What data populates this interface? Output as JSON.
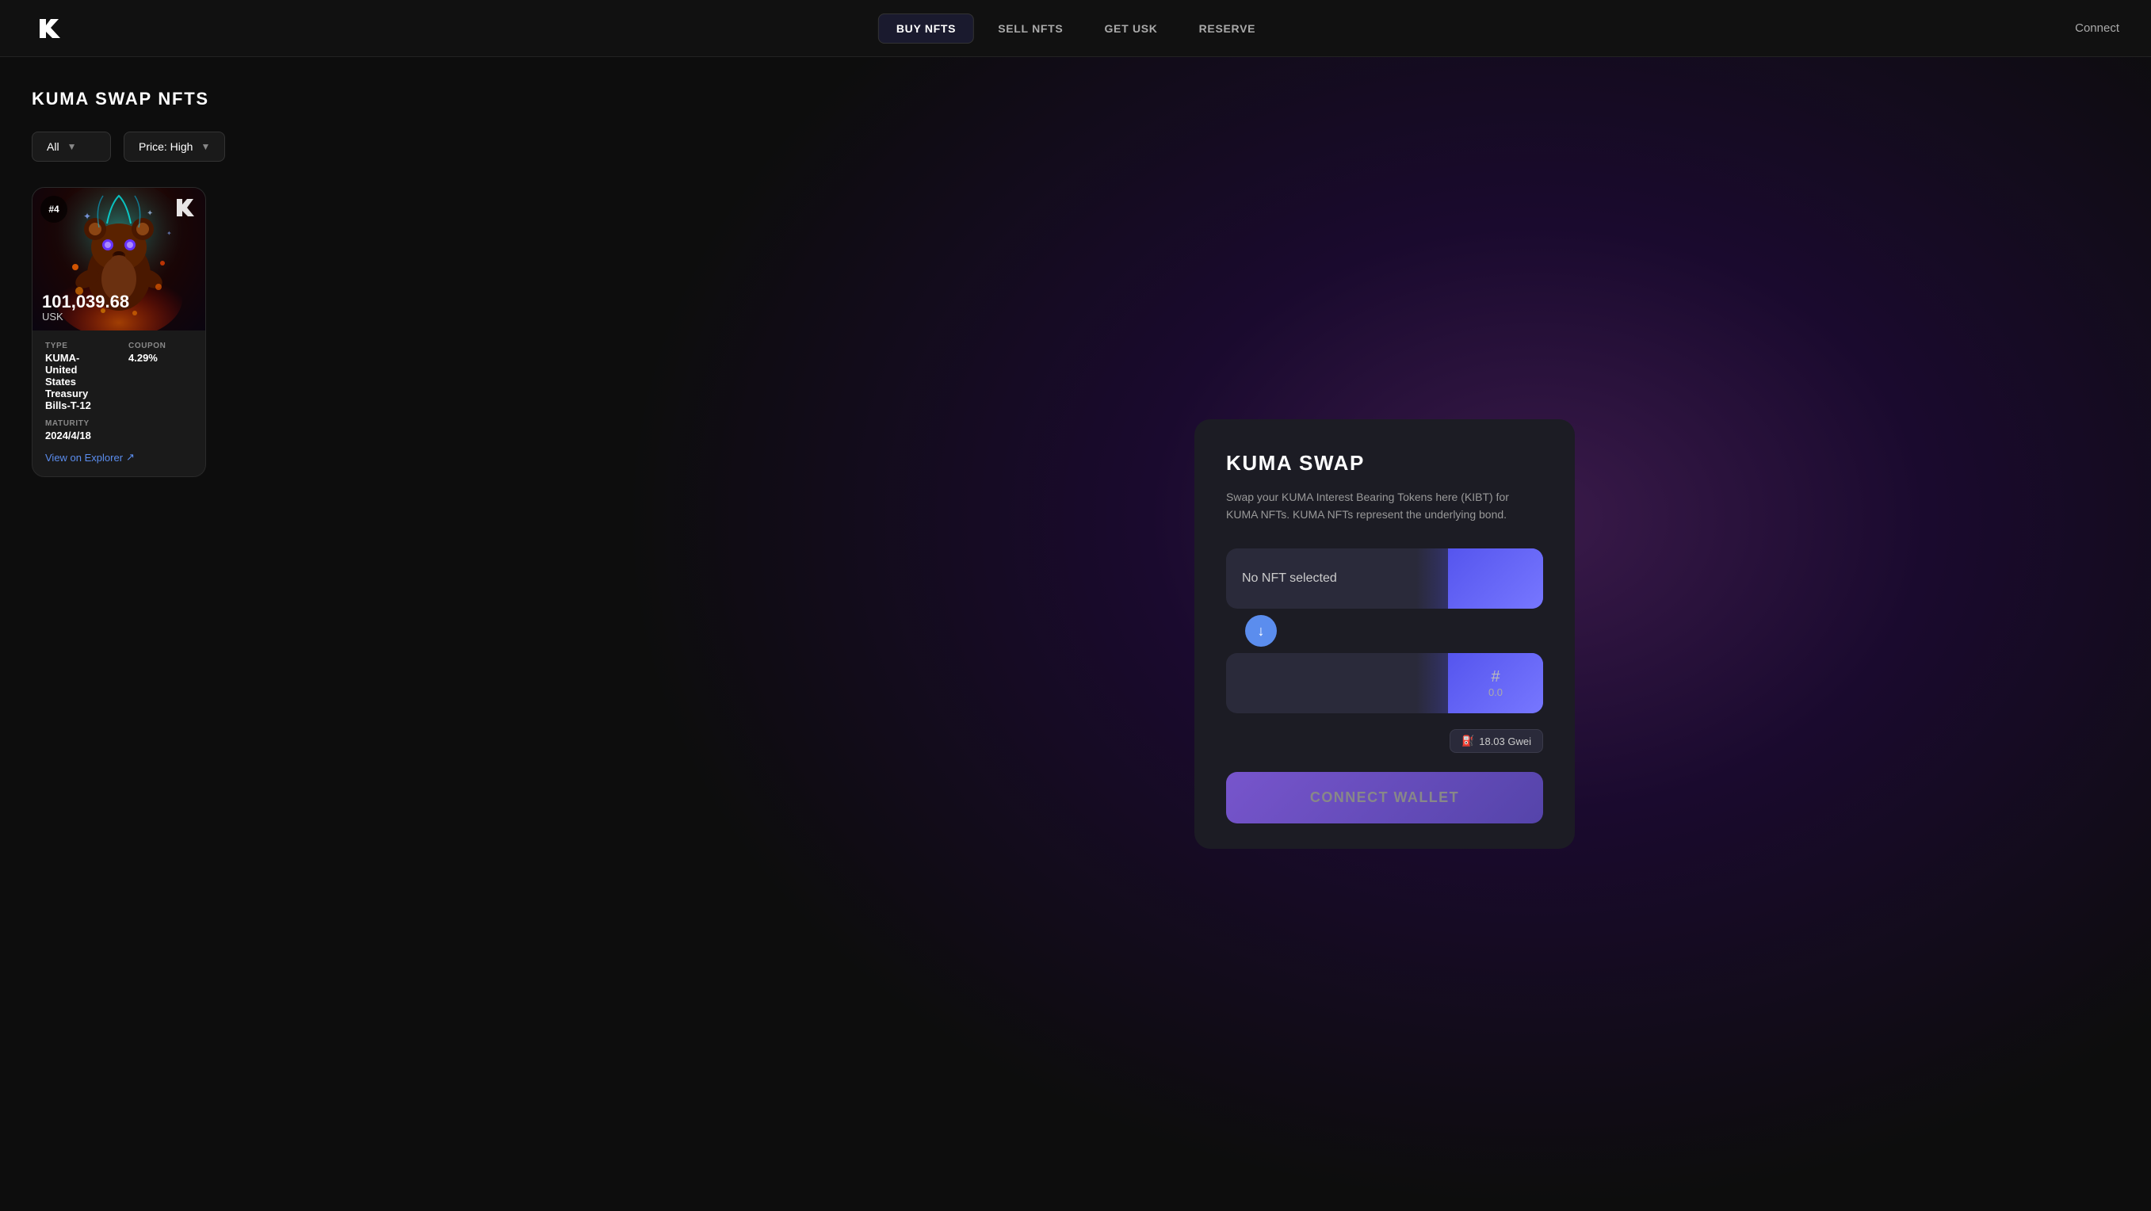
{
  "header": {
    "logo_text": "K",
    "nav_items": [
      {
        "label": "BUY NFTS",
        "active": true
      },
      {
        "label": "SELL NFTS",
        "active": false
      },
      {
        "label": "GET USK",
        "active": false
      },
      {
        "label": "RESERVE",
        "active": false
      }
    ],
    "connect_label": "Connect"
  },
  "page": {
    "title": "KUMA SWAP NFTS"
  },
  "filters": {
    "type_label": "All",
    "price_label": "Price: High"
  },
  "nft_card": {
    "badge": "#4",
    "price": "101,039.68",
    "currency": "USK",
    "type_label": "TYPE",
    "type_value": "KUMA-United States Treasury Bills-T-12",
    "coupon_label": "COUPON",
    "coupon_value": "4.29%",
    "maturity_label": "MATURITY",
    "maturity_value": "2024/4/18",
    "view_explorer_label": "View on Explorer",
    "view_explorer_icon": "↗"
  },
  "swap_card": {
    "title": "KUMA SWAP",
    "description": "Swap your KUMA Interest Bearing Tokens here (KIBT) for KUMA NFTs. KUMA NFTs represent the underlying bond.",
    "no_nft_selected": "No NFT selected",
    "output_hash": "#",
    "output_num": "0.0",
    "gas_icon": "⛽",
    "gas_label": "18.03 Gwei",
    "connect_wallet": "CONNECT WALLET",
    "divider_icon": "↓"
  }
}
